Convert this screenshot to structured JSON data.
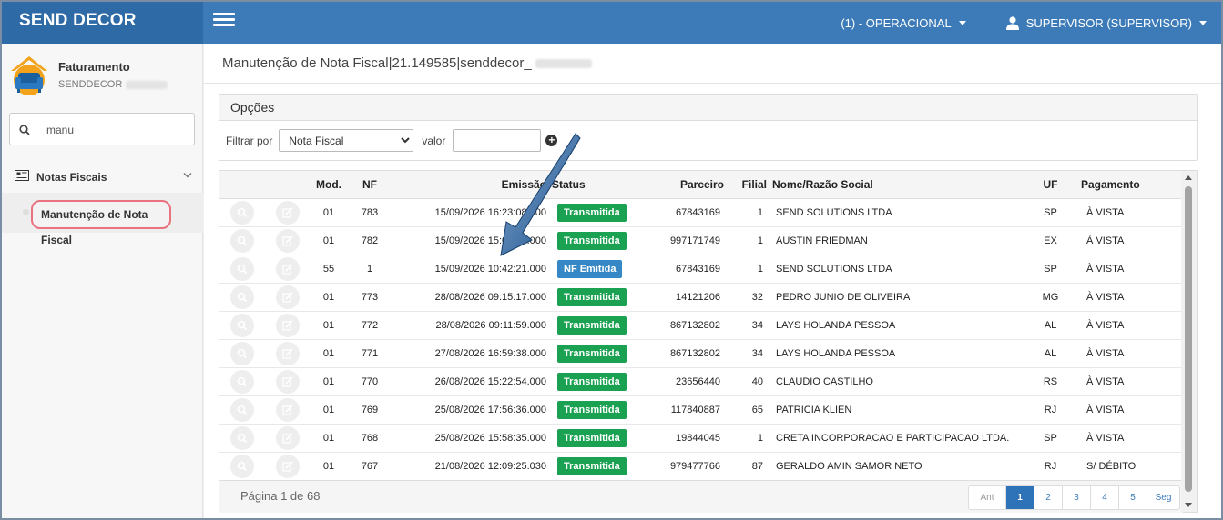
{
  "app": {
    "brand": "SEND DECOR"
  },
  "header": {
    "context_label": "(1) - OPERACIONAL",
    "user_label": "SUPERVISOR (SUPERVISOR)"
  },
  "sidebar": {
    "profile_title": "Faturamento",
    "profile_subtitle": "SENDDECOR",
    "search": {
      "value": "manu"
    },
    "group_label": "Notas Fiscais",
    "active_item": "Manutenção de Nota Fiscal"
  },
  "main": {
    "page_title": "Manutenção de Nota Fiscal|21.149585|senddecor_",
    "options": {
      "title": "Opções",
      "filter_label": "Filtrar por",
      "filter_selected": "Nota Fiscal",
      "value_label": "valor",
      "value_input": ""
    },
    "table": {
      "columns": [
        "",
        "",
        "Mod.",
        "NF",
        "Emissão",
        "Status",
        "Parceiro",
        "Filial",
        "Nome/Razão Social",
        "UF",
        "Pagamento"
      ],
      "rows": [
        {
          "mod": "01",
          "nf": "783",
          "emissao": "15/09/2026 16:23:08.000",
          "status": "Transmitida",
          "parceiro": "67843169",
          "filial": "1",
          "nome": "SEND SOLUTIONS LTDA",
          "uf": "SP",
          "pagamento": "À VISTA"
        },
        {
          "mod": "01",
          "nf": "782",
          "emissao": "15/09/2026 15:05:10.000",
          "status": "Transmitida",
          "parceiro": "997171749",
          "filial": "1",
          "nome": "AUSTIN FRIEDMAN",
          "uf": "EX",
          "pagamento": "À VISTA"
        },
        {
          "mod": "55",
          "nf": "1",
          "emissao": "15/09/2026 10:42:21.000",
          "status": "NF Emitida",
          "parceiro": "67843169",
          "filial": "1",
          "nome": "SEND SOLUTIONS LTDA",
          "uf": "SP",
          "pagamento": "À VISTA"
        },
        {
          "mod": "01",
          "nf": "773",
          "emissao": "28/08/2026 09:15:17.000",
          "status": "Transmitida",
          "parceiro": "14121206",
          "filial": "32",
          "nome": "PEDRO JUNIO DE OLIVEIRA",
          "uf": "MG",
          "pagamento": "À VISTA"
        },
        {
          "mod": "01",
          "nf": "772",
          "emissao": "28/08/2026 09:11:59.000",
          "status": "Transmitida",
          "parceiro": "867132802",
          "filial": "34",
          "nome": "LAYS HOLANDA PESSOA",
          "uf": "AL",
          "pagamento": "À VISTA"
        },
        {
          "mod": "01",
          "nf": "771",
          "emissao": "27/08/2026 16:59:38.000",
          "status": "Transmitida",
          "parceiro": "867132802",
          "filial": "34",
          "nome": "LAYS HOLANDA PESSOA",
          "uf": "AL",
          "pagamento": "À VISTA"
        },
        {
          "mod": "01",
          "nf": "770",
          "emissao": "26/08/2026 15:22:54.000",
          "status": "Transmitida",
          "parceiro": "23656440",
          "filial": "40",
          "nome": "CLAUDIO CASTILHO",
          "uf": "RS",
          "pagamento": "À VISTA"
        },
        {
          "mod": "01",
          "nf": "769",
          "emissao": "25/08/2026 17:56:36.000",
          "status": "Transmitida",
          "parceiro": "117840887",
          "filial": "65",
          "nome": "PATRICIA KLIEN",
          "uf": "RJ",
          "pagamento": "À VISTA"
        },
        {
          "mod": "01",
          "nf": "768",
          "emissao": "25/08/2026 15:58:35.000",
          "status": "Transmitida",
          "parceiro": "19844045",
          "filial": "1",
          "nome": "CRETA INCORPORACAO E PARTICIPACAO LTDA.",
          "uf": "SP",
          "pagamento": "À VISTA"
        },
        {
          "mod": "01",
          "nf": "767",
          "emissao": "21/08/2026 12:09:25.030",
          "status": "Transmitida",
          "parceiro": "979477766",
          "filial": "87",
          "nome": "GERALDO AMIN SAMOR NETO",
          "uf": "RJ",
          "pagamento": "S/ DÉBITO"
        }
      ]
    },
    "pagination": {
      "info": "Página 1 de 68",
      "prev": "Ant",
      "pages": [
        "1",
        "2",
        "3",
        "4",
        "5"
      ],
      "active": "1",
      "next": "Seg"
    }
  },
  "colors": {
    "topbar": "#3c7bb8",
    "brand_bg": "#2e6aa5",
    "status_transmitida": "#1aa152",
    "status_emitida": "#3588c5",
    "highlight_ring": "#e8737f"
  },
  "icons": [
    "hamburger-icon",
    "user-icon",
    "search-icon",
    "newspaper-icon",
    "chevron-down-icon",
    "plus-circle-icon",
    "magnifier-icon",
    "edit-icon",
    "annotation-arrow"
  ]
}
